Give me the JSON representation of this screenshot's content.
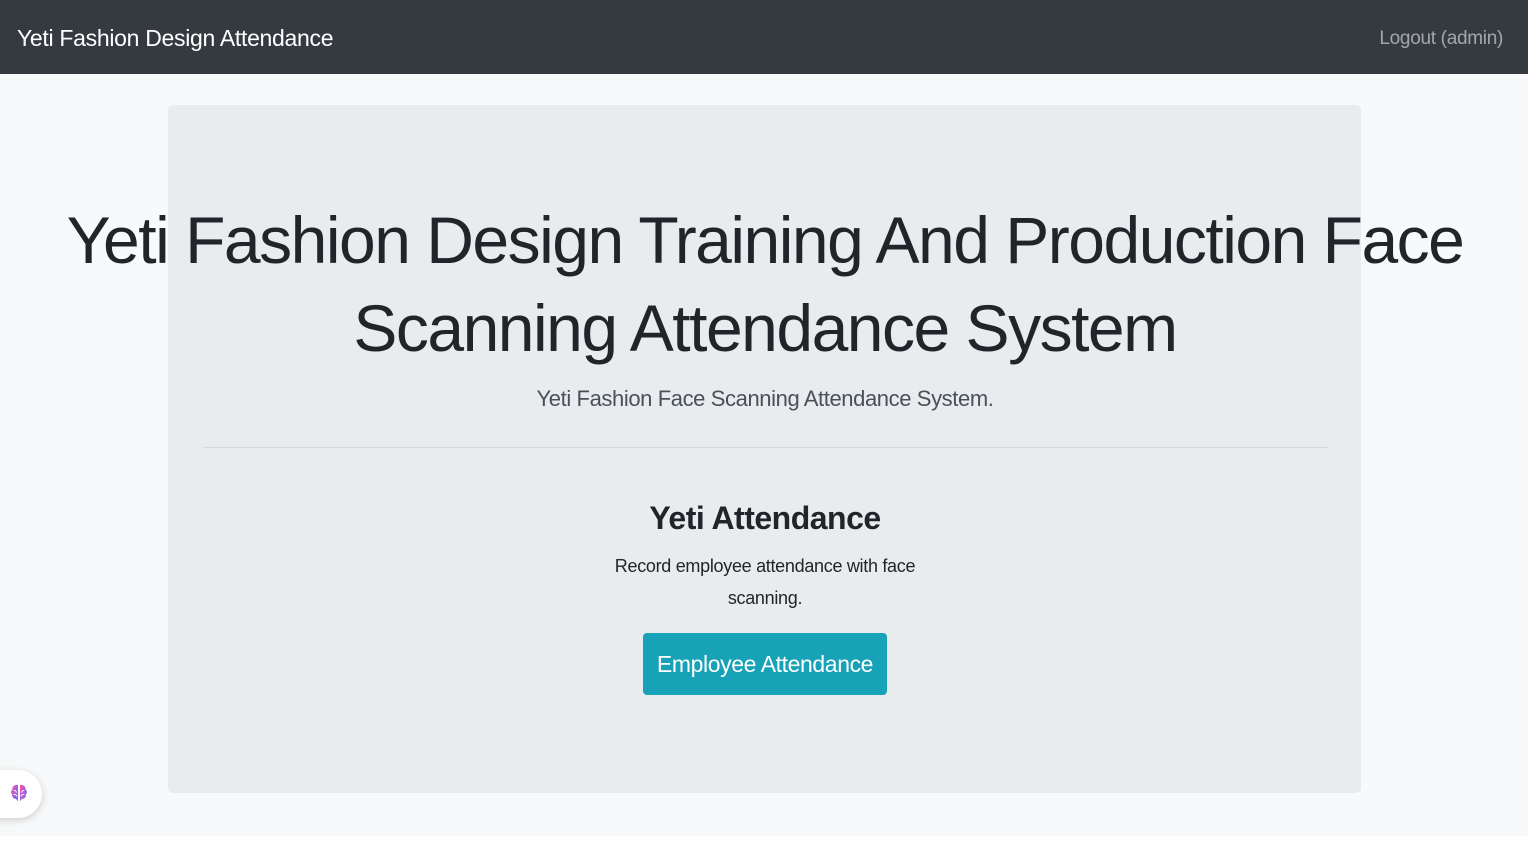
{
  "navbar": {
    "brand": "Yeti Fashion Design Attendance",
    "logout": "Logout (admin)"
  },
  "hero": {
    "title": "Yeti Fashion Design Training And Production Face Scanning Attendance System",
    "subtitle": "Yeti Fashion Face Scanning Attendance System."
  },
  "card": {
    "title": "Yeti Attendance",
    "text": "Record employee attendance with face scanning.",
    "button_label": "Employee Attendance"
  },
  "widget": {
    "icon": "brain-icon"
  },
  "colors": {
    "navbar": "#343a40",
    "page_background": "#f8f9fa",
    "jumbotron": "#e9ecef",
    "button": "#17a2b8",
    "widget_gradient_start": "#ff4fb3",
    "widget_gradient_end": "#5b6cff"
  }
}
